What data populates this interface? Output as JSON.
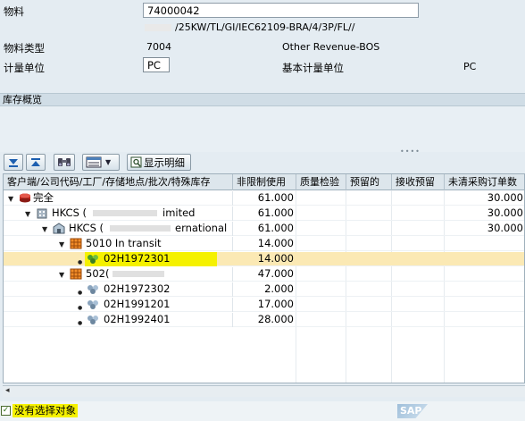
{
  "header": {
    "material_label": "物料",
    "material_value": "74000042",
    "material_desc": "/25KW/TL/GI/IEC62109-BRA/4/3P/FL//",
    "material_type_label": "物料类型",
    "material_type_code": "7004",
    "material_type_text": "Other Revenue-BOS",
    "uom_label": "计量单位",
    "uom_value": "PC",
    "base_uom_label": "基本计量单位",
    "base_uom_value": "PC"
  },
  "section": {
    "title": "库存概览"
  },
  "toolbar": {
    "expand_icon": "expand-all-icon",
    "collapse_icon": "collapse-all-icon",
    "find_icon": "binoculars-icon",
    "layout_icon": "layout-icon",
    "details_icon": "details-icon",
    "details_label": "显示明细"
  },
  "table": {
    "columns": [
      "客户端/公司代码/工厂/存储地点/批次/特殊库存",
      "非限制使用",
      "质量检验",
      "预留的",
      "接收预留",
      "未清采购订单数"
    ],
    "rows": [
      {
        "label": "完全",
        "unrestricted": "61.000",
        "qi": "",
        "reserved": "",
        "recv_res": "",
        "open_po": "30.000"
      },
      {
        "label": "HKCS (",
        "label_tail": "imited",
        "unrestricted": "61.000",
        "qi": "",
        "reserved": "",
        "recv_res": "",
        "open_po": "30.000"
      },
      {
        "label": "HKCS (",
        "label_tail": "ernational",
        "unrestricted": "61.000",
        "qi": "",
        "reserved": "",
        "recv_res": "",
        "open_po": "30.000"
      },
      {
        "label": "5010 In transit",
        "unrestricted": "14.000",
        "qi": "",
        "reserved": "",
        "recv_res": "",
        "open_po": ""
      },
      {
        "label": "02H1972301",
        "unrestricted": "14.000",
        "qi": "",
        "reserved": "",
        "recv_res": "",
        "open_po": ""
      },
      {
        "label": "502(",
        "unrestricted": "47.000",
        "qi": "",
        "reserved": "",
        "recv_res": "",
        "open_po": ""
      },
      {
        "label": "02H1972302",
        "unrestricted": "2.000",
        "qi": "",
        "reserved": "",
        "recv_res": "",
        "open_po": ""
      },
      {
        "label": "02H1991201",
        "unrestricted": "17.000",
        "qi": "",
        "reserved": "",
        "recv_res": "",
        "open_po": ""
      },
      {
        "label": "02H1992401",
        "unrestricted": "28.000",
        "qi": "",
        "reserved": "",
        "recv_res": "",
        "open_po": ""
      }
    ]
  },
  "status": {
    "text": "没有选择对象",
    "logo": "SAP"
  }
}
